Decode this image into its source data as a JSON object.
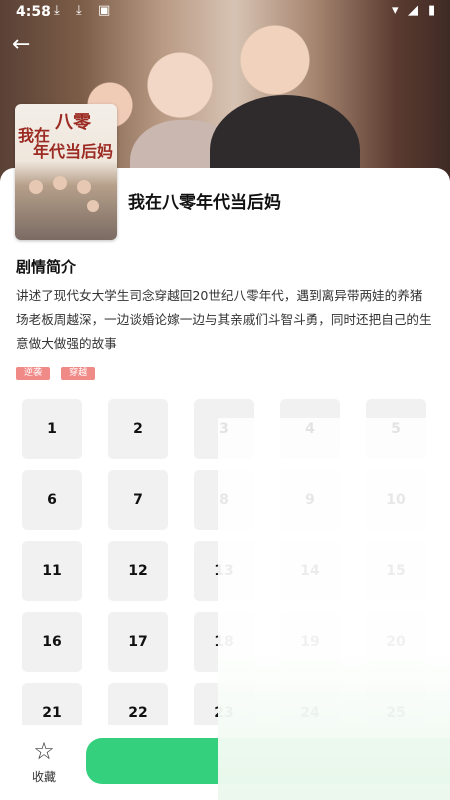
{
  "status_bar": {
    "time": "4:58"
  },
  "drama": {
    "title": "我在八零年代当后妈",
    "poster_title_line1": "八零",
    "poster_title_line2": "我在",
    "poster_title_line3": "年代当后妈"
  },
  "synopsis": {
    "heading": "剧情简介",
    "text": "讲述了现代女大学生司念穿越回20世纪八零年代，遇到离异带两娃的养猪场老板周越深，一边谈婚论嫁一边与其亲戚们斗智斗勇，同时还把自己的生意做大做强的故事"
  },
  "tags": [
    "逆袭",
    "穿越"
  ],
  "episodes": [
    "1",
    "2",
    "3",
    "4",
    "5",
    "6",
    "7",
    "8",
    "9",
    "10",
    "11",
    "12",
    "13",
    "14",
    "15",
    "16",
    "17",
    "18",
    "19",
    "20",
    "21",
    "22",
    "23",
    "24",
    "25"
  ],
  "bottom_bar": {
    "favorite_label": "收藏"
  }
}
